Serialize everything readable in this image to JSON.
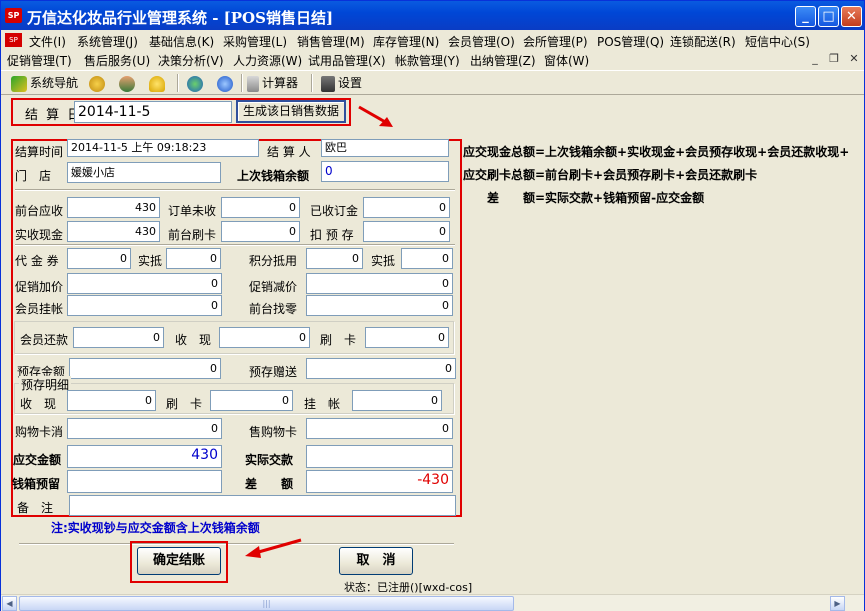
{
  "window": {
    "title": "万信达化妆品行业管理系统 - [POS销售日结]",
    "logo_text": "SP",
    "min": "_",
    "max": "□",
    "close": "✕"
  },
  "menu": {
    "row1": [
      "文件(I)",
      "系统管理(J)",
      "基础信息(K)",
      "采购管理(L)",
      "销售管理(M)",
      "库存管理(N)",
      "会员管理(O)",
      "会所管理(P)",
      "POS管理(Q)",
      "连锁配送(R)",
      "短信中心(S)"
    ],
    "row2": [
      "促销管理(T)",
      "售后服务(U)",
      "决策分析(V)",
      "人力资源(W)",
      "试用品管理(X)",
      "帐款管理(Y)",
      "出纳管理(Z)",
      "窗体(W)"
    ],
    "mdi": [
      "_",
      "❐",
      "✕"
    ]
  },
  "toolbar": {
    "nav": "系统导航",
    "calc": "计算器",
    "settings": "设置"
  },
  "date": {
    "label": "结 算 日",
    "value": "2014-11-5",
    "gen_button": "生成该日销售数据"
  },
  "form": {
    "settle_time_label": "结算时间",
    "settle_time": "2014-11-5 上午 09:18:23",
    "settler_label": "结 算 人",
    "settler": "欧巴",
    "store_label": "门　店",
    "store": "媛媛小店",
    "last_cash_label": "上次钱箱余额",
    "last_cash": "0",
    "front_receivable_label": "前台应收",
    "front_receivable": "430",
    "order_unpaid_label": "订单未收",
    "order_unpaid": "0",
    "received_deposit_label": "已收订金",
    "received_deposit": "0",
    "actual_cash_label": "实收现金",
    "actual_cash": "430",
    "front_card_label": "前台刷卡",
    "front_card": "0",
    "deduct_prestore_label": "扣 预 存",
    "deduct_prestore": "0",
    "voucher_label": "代 金 券",
    "voucher": "0",
    "voucher_offset_label": "实抵",
    "voucher_offset": "0",
    "points_label": "积分抵用",
    "points": "0",
    "points_offset_label": "实抵",
    "points_offset": "0",
    "promo_add_label": "促销加价",
    "promo_add": "0",
    "promo_cut_label": "促销减价",
    "promo_cut": "0",
    "member_credit_label": "会员挂帐",
    "member_credit": "0",
    "front_change_label": "前台找零",
    "front_change": "0",
    "member_repay_label": "会员还款",
    "member_repay": "0",
    "repay_cash_label": "收　现",
    "repay_cash": "0",
    "repay_card_label": "刷　卡",
    "repay_card": "0",
    "prestore_amount_label": "预存金额",
    "prestore_amount": "0",
    "prestore_gift_label": "预存赠送",
    "prestore_gift": "0",
    "prestore_detail_label": "预存明细",
    "pd_cash_label": "收　现",
    "pd_cash": "0",
    "pd_card_label": "刷　卡",
    "pd_card": "0",
    "pd_credit_label": "挂　帐",
    "pd_credit": "0",
    "shopcard_cancel_label": "购物卡消",
    "shopcard_cancel": "0",
    "shopcard_sell_label": "售购物卡",
    "shopcard_sell": "0",
    "due_total_label": "应交金额",
    "due_total": "430",
    "actual_paid_label": "实际交款",
    "actual_paid": "",
    "cash_reserve_label": "钱箱预留",
    "cash_reserve": "",
    "diff_label": "差　　额",
    "diff": "-430",
    "remark_label": "备　注",
    "remark": ""
  },
  "formulas": [
    "应交现金总额=上次钱箱余额+实收现金+会员预存收现+会员还款收现+",
    "应交刷卡总额=前台刷卡+会员预存刷卡+会员还款刷卡",
    "差　　额=实际交款+钱箱预留-应交金额"
  ],
  "note": "注:实收现钞与应交金额含上次钱箱余额",
  "buttons": {
    "confirm": "确定结账",
    "cancel": "取　消"
  },
  "status": "状态：已注册()[wxd-cos]",
  "colors": {
    "title_bar": "#0a5be0",
    "highlight": "#e00000",
    "note": "#0000cc",
    "negative": "#e00000",
    "due_value": "#0000cc"
  }
}
